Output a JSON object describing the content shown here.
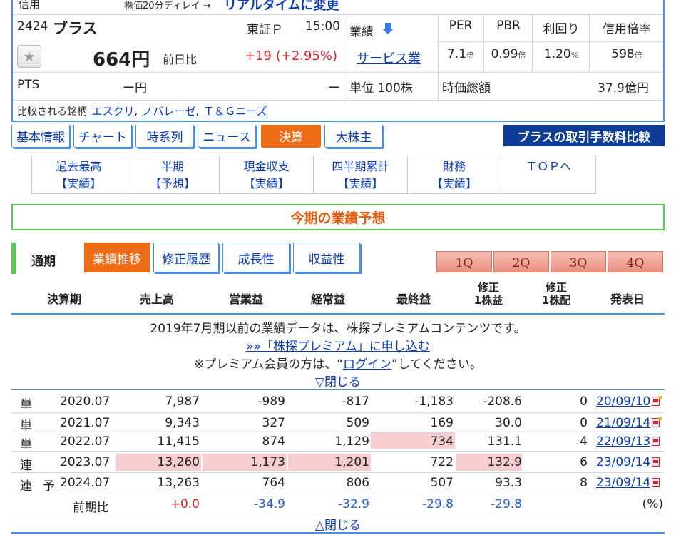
{
  "header": {
    "credit": "信用",
    "delay_note": "株価20分ディレイ →",
    "realtime_link": "リアルタイムに変更"
  },
  "stock": {
    "code": "2424",
    "name": "ブラス",
    "market": "東証Ｐ",
    "time": "15:00",
    "performance_label": "業績",
    "price": "664円",
    "prev_label": "前日比",
    "change": "+19 (+2.95%)",
    "sector": "サービス業",
    "pts_label": "PTS",
    "pts_price": "ー円",
    "pts_change": "ー",
    "unit": "単位 100株",
    "market_cap_label": "時価総額",
    "market_cap": "37.9億円",
    "compare_label": "比較される銘柄",
    "compare": [
      "エスクリ",
      "ノバレーゼ",
      "Ｔ＆Ｇニーズ"
    ],
    "metrics": [
      {
        "label": "PER",
        "value": "7.1",
        "unit": "倍"
      },
      {
        "label": "PBR",
        "value": "0.99",
        "unit": "倍"
      },
      {
        "label": "利回り",
        "value": "1.20",
        "unit": "%"
      },
      {
        "label": "信用倍率",
        "value": "598",
        "unit": "倍"
      }
    ]
  },
  "tabs": [
    "基本情報",
    "チャート",
    "時系列",
    "ニュース",
    "決算",
    "大株主"
  ],
  "fee_button": "ブラスの取引手数料比較",
  "subnav": [
    {
      "line1": "過去最高",
      "line2": "【実績】"
    },
    {
      "line1": "半期",
      "line2": "【予想】"
    },
    {
      "line1": "現金収支",
      "line2": "【実績】"
    },
    {
      "line1": "四半期累計",
      "line2": "【実績】"
    },
    {
      "line1": "財務",
      "line2": "【実績】"
    },
    {
      "line1": "ＴＯＰへ",
      "line2": ""
    }
  ],
  "forecast_title": "今期の業績予想",
  "period": {
    "label": "通期",
    "tabs": [
      "業績推移",
      "修正履歴",
      "成長性",
      "収益性"
    ],
    "quarters": [
      "1Q",
      "2Q",
      "3Q",
      "4Q"
    ]
  },
  "table": {
    "headers": [
      "決算期",
      "売上高",
      "営業益",
      "経常益",
      "最終益",
      "修正",
      "1株益",
      "修正",
      "1株配",
      "発表日"
    ],
    "notice": {
      "line1": "2019年7月期以前の業績データは、株探プレミアムコンテンツです。",
      "line2": "»»「株探プレミアム」に申し込む",
      "line3_a": "※プレミアム会員の方は、“",
      "line3_link": "ログイン",
      "line3_b": "”してください。",
      "close_top": "▽閉じる"
    },
    "rows": [
      {
        "type": "単",
        "forecast": "",
        "period": "2020.07",
        "sales": "7,987",
        "op": "-989",
        "ord": "-817",
        "net": "-1,183",
        "eps": "-208.6",
        "div": "0",
        "date": "20/09/10"
      },
      {
        "type": "単",
        "forecast": "",
        "period": "2021.07",
        "sales": "9,343",
        "op": "327",
        "ord": "509",
        "net": "169",
        "eps": "30.0",
        "div": "0",
        "date": "21/09/14"
      },
      {
        "type": "単",
        "forecast": "",
        "period": "2022.07",
        "sales": "11,415",
        "op": "874",
        "ord": "1,129",
        "net": "734",
        "eps": "131.1",
        "div": "4",
        "date": "22/09/13"
      },
      {
        "type": "連",
        "forecast": "",
        "period": "2023.07",
        "sales": "13,260",
        "op": "1,173",
        "ord": "1,201",
        "net": "722",
        "eps": "132.9",
        "div": "6",
        "date": "23/09/14"
      },
      {
        "type": "連",
        "forecast": "予",
        "period": "2024.07",
        "sales": "13,263",
        "op": "764",
        "ord": "806",
        "net": "507",
        "eps": "93.3",
        "div": "8",
        "date": "23/09/14"
      }
    ],
    "yoy": {
      "label": "前期比",
      "sales": "+0.0",
      "op": "-34.9",
      "ord": "-32.9",
      "net": "-29.8",
      "eps": "-29.8",
      "unit": "(%)"
    },
    "close_bottom": "△閉じる"
  }
}
